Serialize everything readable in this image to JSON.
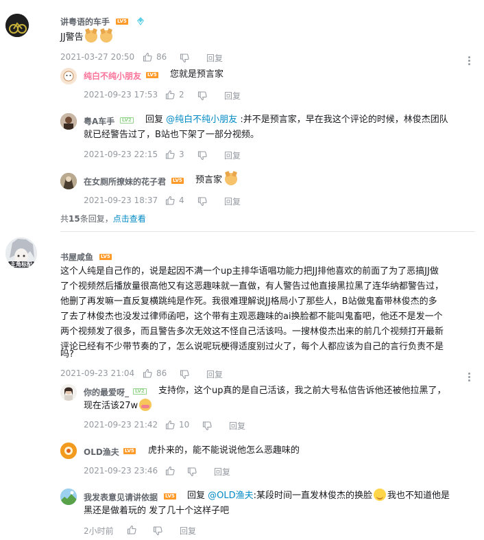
{
  "comments": [
    {
      "user": "讲粤语的车手",
      "level": "LV5",
      "text": "JJ警告",
      "emojis": [
        "dog-emoji",
        "dog-emoji"
      ],
      "time": "2021-03-27 20:50",
      "likes": "86",
      "reply_label": "回复",
      "replies": [
        {
          "user": "纯白不纯小朋友",
          "level": "LV5",
          "text": "您就是预言家",
          "time": "2021-09-23 17:53",
          "likes": "2",
          "reply_label": "回复"
        },
        {
          "user": "粤A车手",
          "level": "LV2",
          "reply_prefix": "回复",
          "reply_to": "@纯白不纯小朋友",
          "text_line1": ":并不是预言家，早在我这个评论的时候，林俊杰团队",
          "text_line2": "就已经警告过了，B站也下架了一部分视频。",
          "time": "2021-09-23 22:15",
          "likes": "3",
          "reply_label": "回复"
        },
        {
          "user": "在女厕所撩妹的花子君",
          "level": "LV5",
          "text": "预言家",
          "time": "2021-09-23 18:37",
          "likes": "4",
          "reply_label": "回复"
        }
      ],
      "reply_summary_prefix": "共",
      "reply_summary_count": "15",
      "reply_summary_suffix": "条回复，",
      "reply_summary_link": "点击查看"
    },
    {
      "user": "书屋咸鱼",
      "level": "LV5",
      "avatar_badge": "主角标配",
      "text_lines": [
        "这个人纯是自己作的，说是起因不满一个up主排华语唱功能力把JJ排他喜欢的前面了为了恶搞JJ做",
        "了个视频然后播放量很高他又有这恶趣味就一直做，有人警告过他直接黑拉黑了连华纳都警告过，",
        "他删了再发嘛一直反复横跳纯是作死。我很难理解说JJ格局小了那些人，B站做鬼畜带林俊杰的多",
        "了去了林俊杰也没发过律师函吧，这个带有主观恶趣味的ai换脸都不能叫鬼畜吧，他还不是发一个",
        "两个视频发了很多，而且警告多次无效这不怪自己活该吗。一搜林俊杰出来的前几个视频打开最新",
        "评论已经有不少带节奏的了，怎么说呢玩梗得适度别过火了，每个人都应该为自己的言行负责不是",
        "吗?"
      ],
      "time": "2021-09-23 21:04",
      "likes": "86",
      "reply_label": "回复",
      "replies": [
        {
          "user": "你的最爱呀_",
          "level": "LV2",
          "text_line1": "支持你，这个up真的是自己活该，我之前大号私信告诉他还被他拉黑了，",
          "text_line2": "现在活该27w",
          "time": "2021-09-23 21:42",
          "likes": "10",
          "reply_label": "回复"
        },
        {
          "user": "OLD渔夫",
          "level": "LV5",
          "text": "虎扑来的，能不能说说他怎么恶趣味的",
          "time": "2021-09-23 23:46",
          "likes": "",
          "reply_label": "回复"
        },
        {
          "user": "我发表意见请讲依据",
          "level": "LV5",
          "reply_prefix": "回复",
          "reply_to": "@OLD渔夫",
          "text_line1_a": ":某段时间一直发林俊杰的换脸",
          "text_line1_b": "我也不知道他是",
          "text_line2": "黑还是做着玩的 发了几十个这样子吧",
          "time": "2小时前",
          "likes": "",
          "reply_label": "回复"
        }
      ]
    }
  ],
  "colors": {
    "accent_blue": "#008ac5",
    "pink_name": "#fb7299",
    "meta_gray": "#9499a0",
    "level5": "#ff9a28",
    "level2": "#8ed386"
  }
}
